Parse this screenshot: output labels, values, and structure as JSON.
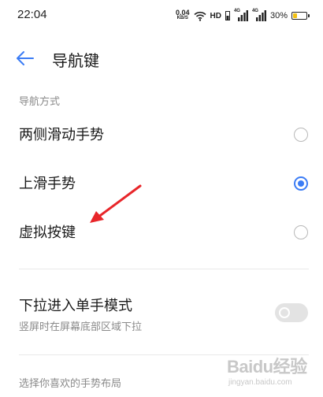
{
  "status_bar": {
    "time": "22:04",
    "net_speed_value": "0.04",
    "net_speed_unit": "KB/S",
    "hd_label": "HD",
    "sim1_tech": "4G",
    "sim2_tech": "4G",
    "battery_percent": "30%",
    "battery_level": 0.3,
    "icons": [
      "wifi-icon",
      "signal-icon",
      "battery-icon"
    ]
  },
  "header": {
    "title": "导航键",
    "back_icon": "arrow-left-icon"
  },
  "nav_mode": {
    "section_label": "导航方式",
    "options": [
      {
        "label": "两侧滑动手势",
        "selected": false
      },
      {
        "label": "上滑手势",
        "selected": true
      },
      {
        "label": "虚拟按键",
        "selected": false
      }
    ]
  },
  "one_hand": {
    "title": "下拉进入单手模式",
    "subtitle": "竖屏时在屏幕底部区域下拉",
    "enabled": false
  },
  "gesture_layout": {
    "section_label": "选择你喜欢的手势布局"
  },
  "watermark": {
    "brand": "Baidu经验",
    "url": "jingyan.baidu.com"
  },
  "colors": {
    "accent": "#3b7cf5",
    "annotation_arrow": "#e8262a",
    "secondary_text": "#8a8a8a"
  }
}
